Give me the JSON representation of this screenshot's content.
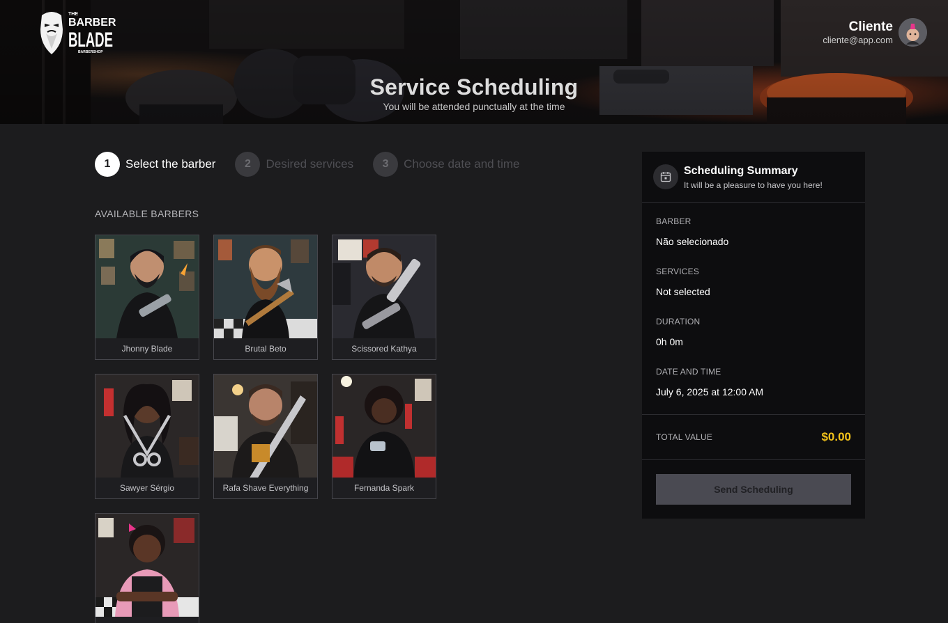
{
  "header": {
    "logo": {
      "top_text": "THE",
      "main_text": "BARBER'S",
      "blade_text": "BLADE",
      "sub_text": "BARBERSHOP"
    },
    "user": {
      "name": "Cliente",
      "email": "cliente@app.com"
    },
    "title": "Service Scheduling",
    "subtitle": "You will be attended punctually at the time"
  },
  "steps": [
    {
      "number": "1",
      "label": "Select the barber",
      "active": true
    },
    {
      "number": "2",
      "label": "Desired services",
      "active": false
    },
    {
      "number": "3",
      "label": "Choose date and time",
      "active": false
    }
  ],
  "barbers_section": {
    "label": "AVAILABLE BARBERS",
    "barbers": [
      {
        "name": "Jhonny Blade"
      },
      {
        "name": "Brutal Beto"
      },
      {
        "name": "Scissored Kathya"
      },
      {
        "name": "Sawyer Sérgio"
      },
      {
        "name": "Rafa Shave Everything"
      },
      {
        "name": "Fernanda Spark"
      },
      {
        "name": ""
      }
    ]
  },
  "summary": {
    "title": "Scheduling Summary",
    "subtitle": "It will be a pleasure to have you here!",
    "rows": [
      {
        "label": "BARBER",
        "value": "Não selecionado"
      },
      {
        "label": "SERVICES",
        "value": "Not selected"
      },
      {
        "label": "DURATION",
        "value": "0h 0m"
      },
      {
        "label": "DATE AND TIME",
        "value": "July 6, 2025 at 12:00 AM"
      }
    ],
    "total_label": "TOTAL VALUE",
    "total_value": "$0.00",
    "send_button": "Send Scheduling"
  },
  "colors": {
    "accent_gold": "#f2c21a",
    "background": "#1c1c1e",
    "panel": "#0d0d0f",
    "button_disabled": "#4a4a52"
  }
}
